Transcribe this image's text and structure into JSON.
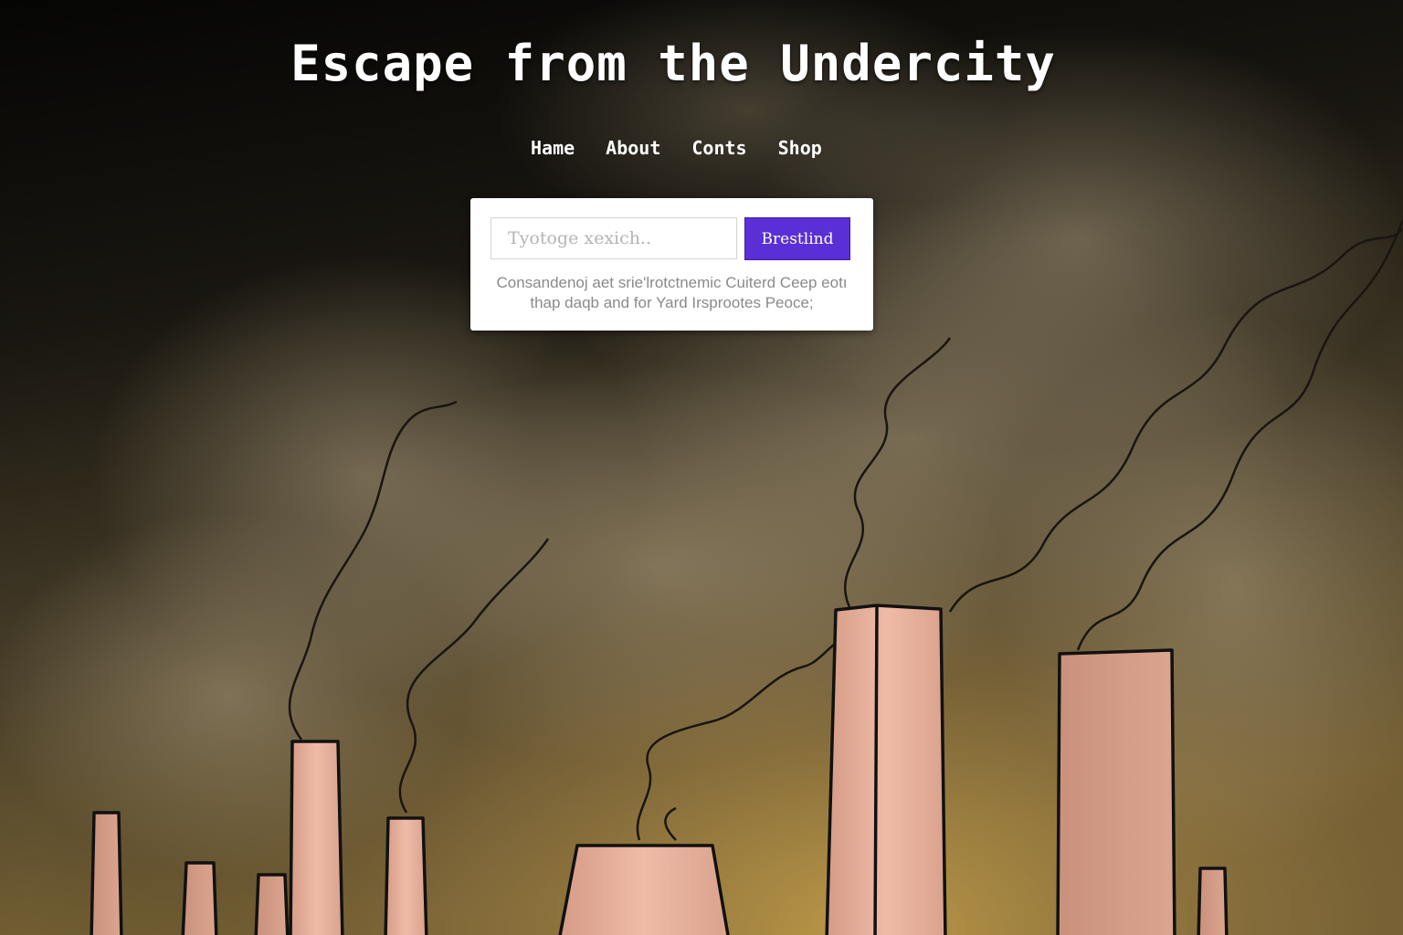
{
  "page": {
    "title": "Escape from the Undercity"
  },
  "nav": {
    "items": [
      {
        "label": "Hame"
      },
      {
        "label": "About"
      },
      {
        "label": "Conts"
      },
      {
        "label": "Shop"
      }
    ]
  },
  "search": {
    "placeholder": "Tyotoge xexich..",
    "value": "",
    "button_label": "Brestlind",
    "button_color": "#5b2fd6",
    "description": "Consandenoj aet srie'lrotctnemic Cuiterd Ceep eotı thap daqb and for Yard Irsprootes Peoce;"
  },
  "theme": {
    "sky_top": "#050504",
    "smoke": "#8b7d5a",
    "glow": "#c9a24a",
    "chimney_fill": "#e2a98f",
    "chimney_outline": "#111111"
  }
}
